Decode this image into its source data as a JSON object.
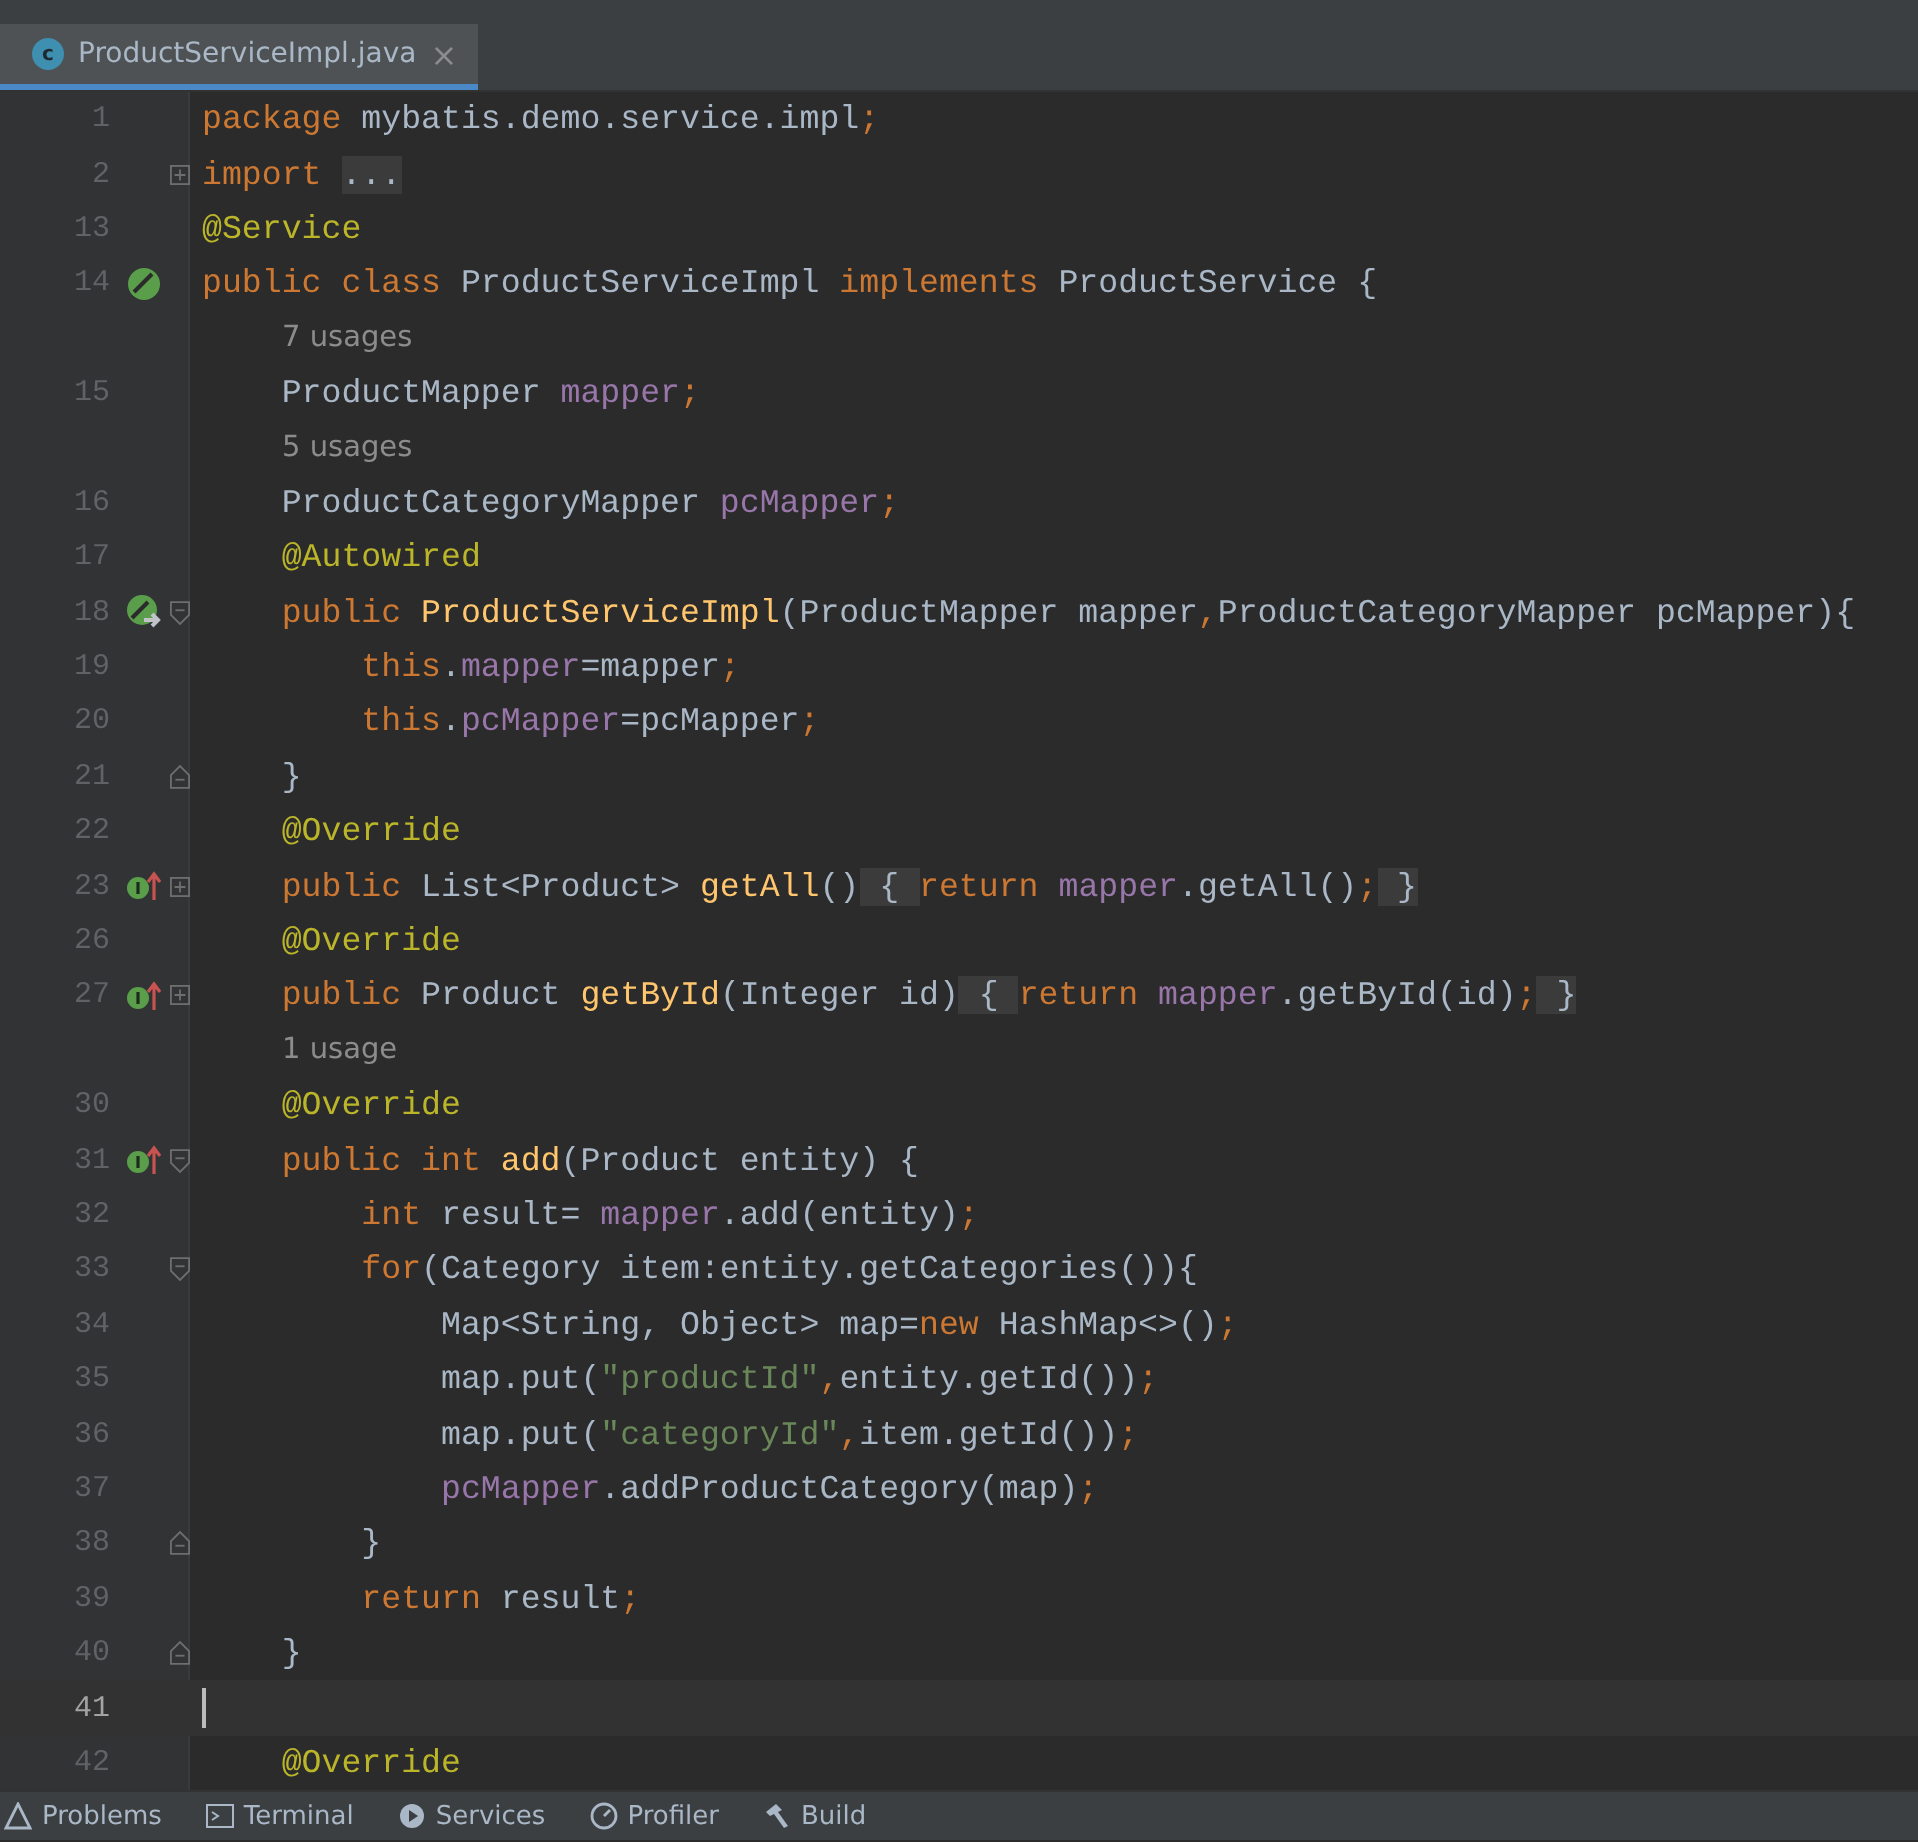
{
  "tab": {
    "title": "ProductServiceImpl.java",
    "icon_letter": "c",
    "close": "×",
    "selected": true
  },
  "lines": [
    {
      "kind": "code",
      "number": "1",
      "current": false,
      "tokens": [
        {
          "kind": "kw",
          "text": "package "
        },
        {
          "kind": "plain",
          "text": "mybatis.demo.service.impl"
        },
        {
          "kind": "kw",
          "text": ";"
        }
      ]
    },
    {
      "kind": "code",
      "number": "2",
      "current": false,
      "fold_marker": {
        "kind": "collapsed"
      },
      "tokens": [
        {
          "kind": "kw",
          "text": "import "
        },
        {
          "kind": "fold",
          "text": "..."
        }
      ]
    },
    {
      "kind": "code",
      "number": "13",
      "current": false,
      "tokens": [
        {
          "kind": "ann",
          "text": "@Service"
        }
      ]
    },
    {
      "kind": "code",
      "number": "14",
      "current": false,
      "gutter_icon": {
        "kind": "bean"
      },
      "tokens": [
        {
          "kind": "kw",
          "text": "public class "
        },
        {
          "kind": "plain",
          "text": "ProductServiceImpl "
        },
        {
          "kind": "kw",
          "text": "implements "
        },
        {
          "kind": "plain",
          "text": "ProductService {"
        }
      ]
    },
    {
      "kind": "hint",
      "text": "7 usages"
    },
    {
      "kind": "code",
      "number": "15",
      "current": false,
      "tokens": [
        {
          "kind": "plain",
          "text": "    ProductMapper "
        },
        {
          "kind": "field",
          "text": "mapper"
        },
        {
          "kind": "kw",
          "text": ";"
        }
      ]
    },
    {
      "kind": "hint",
      "text": "5 usages"
    },
    {
      "kind": "code",
      "number": "16",
      "current": false,
      "tokens": [
        {
          "kind": "plain",
          "text": "    ProductCategoryMapper "
        },
        {
          "kind": "field",
          "text": "pcMapper"
        },
        {
          "kind": "kw",
          "text": ";"
        }
      ]
    },
    {
      "kind": "code",
      "number": "17",
      "current": false,
      "tokens": [
        {
          "kind": "ann",
          "text": "    @Autowired"
        }
      ]
    },
    {
      "kind": "code",
      "number": "18",
      "current": false,
      "gutter_icon": {
        "kind": "autowired"
      },
      "fold_marker": {
        "kind": "start"
      },
      "tokens": [
        {
          "kind": "kw",
          "text": "    public "
        },
        {
          "kind": "decl",
          "text": "ProductServiceImpl"
        },
        {
          "kind": "plain",
          "text": "(ProductMapper mapper"
        },
        {
          "kind": "kw",
          "text": ","
        },
        {
          "kind": "plain",
          "text": "ProductCategoryMapper pcMapper){"
        }
      ]
    },
    {
      "kind": "code",
      "number": "19",
      "current": false,
      "tokens": [
        {
          "kind": "kw",
          "text": "        this"
        },
        {
          "kind": "plain",
          "text": "."
        },
        {
          "kind": "field",
          "text": "mapper"
        },
        {
          "kind": "plain",
          "text": "=mapper"
        },
        {
          "kind": "kw",
          "text": ";"
        }
      ]
    },
    {
      "kind": "code",
      "number": "20",
      "current": false,
      "tokens": [
        {
          "kind": "kw",
          "text": "        this"
        },
        {
          "kind": "plain",
          "text": "."
        },
        {
          "kind": "field",
          "text": "pcMapper"
        },
        {
          "kind": "plain",
          "text": "=pcMapper"
        },
        {
          "kind": "kw",
          "text": ";"
        }
      ]
    },
    {
      "kind": "code",
      "number": "21",
      "current": false,
      "fold_marker": {
        "kind": "end"
      },
      "tokens": [
        {
          "kind": "plain",
          "text": "    }"
        }
      ]
    },
    {
      "kind": "code",
      "number": "22",
      "current": false,
      "tokens": [
        {
          "kind": "ann",
          "text": "    @Override"
        }
      ]
    },
    {
      "kind": "code",
      "number": "23",
      "current": false,
      "gutter_icon": {
        "kind": "implements"
      },
      "fold_marker": {
        "kind": "collapsed"
      },
      "tokens": [
        {
          "kind": "kw",
          "text": "    public "
        },
        {
          "kind": "plain",
          "text": "List<Product> "
        },
        {
          "kind": "decl",
          "text": "getAll"
        },
        {
          "kind": "plain",
          "text": "()"
        },
        {
          "kind": "fold",
          "text": " { "
        },
        {
          "kind": "kw",
          "text": "return "
        },
        {
          "kind": "field",
          "text": "mapper"
        },
        {
          "kind": "plain",
          "text": ".getAll()"
        },
        {
          "kind": "kw",
          "text": ";"
        },
        {
          "kind": "fold",
          "text": " }"
        }
      ]
    },
    {
      "kind": "code",
      "number": "26",
      "current": false,
      "tokens": [
        {
          "kind": "ann",
          "text": "    @Override"
        }
      ]
    },
    {
      "kind": "code",
      "number": "27",
      "current": false,
      "gutter_icon": {
        "kind": "implements"
      },
      "fold_marker": {
        "kind": "collapsed"
      },
      "tokens": [
        {
          "kind": "kw",
          "text": "    public "
        },
        {
          "kind": "plain",
          "text": "Product "
        },
        {
          "kind": "decl",
          "text": "getById"
        },
        {
          "kind": "plain",
          "text": "(Integer id)"
        },
        {
          "kind": "fold",
          "text": " { "
        },
        {
          "kind": "kw",
          "text": "return "
        },
        {
          "kind": "field",
          "text": "mapper"
        },
        {
          "kind": "plain",
          "text": ".getById(id)"
        },
        {
          "kind": "kw",
          "text": ";"
        },
        {
          "kind": "fold",
          "text": " }"
        }
      ]
    },
    {
      "kind": "hint",
      "text": "1 usage"
    },
    {
      "kind": "code",
      "number": "30",
      "current": false,
      "tokens": [
        {
          "kind": "ann",
          "text": "    @Override"
        }
      ]
    },
    {
      "kind": "code",
      "number": "31",
      "current": false,
      "gutter_icon": {
        "kind": "implements"
      },
      "fold_marker": {
        "kind": "start"
      },
      "tokens": [
        {
          "kind": "kw",
          "text": "    public int "
        },
        {
          "kind": "decl",
          "text": "add"
        },
        {
          "kind": "plain",
          "text": "(Product entity) {"
        }
      ]
    },
    {
      "kind": "code",
      "number": "32",
      "current": false,
      "tokens": [
        {
          "kind": "kw",
          "text": "        int "
        },
        {
          "kind": "plain",
          "text": "result= "
        },
        {
          "kind": "field",
          "text": "mapper"
        },
        {
          "kind": "plain",
          "text": ".add(entity)"
        },
        {
          "kind": "kw",
          "text": ";"
        }
      ]
    },
    {
      "kind": "code",
      "number": "33",
      "current": false,
      "fold_marker": {
        "kind": "start"
      },
      "tokens": [
        {
          "kind": "kw",
          "text": "        for"
        },
        {
          "kind": "plain",
          "text": "(Category item:entity.getCategories()){"
        }
      ]
    },
    {
      "kind": "code",
      "number": "34",
      "current": false,
      "tokens": [
        {
          "kind": "plain",
          "text": "            Map<String, Object> map="
        },
        {
          "kind": "kw",
          "text": "new "
        },
        {
          "kind": "plain",
          "text": "HashMap<>()"
        },
        {
          "kind": "kw",
          "text": ";"
        }
      ]
    },
    {
      "kind": "code",
      "number": "35",
      "current": false,
      "tokens": [
        {
          "kind": "plain",
          "text": "            map.put("
        },
        {
          "kind": "str",
          "text": "\"productId\""
        },
        {
          "kind": "kw",
          "text": ","
        },
        {
          "kind": "plain",
          "text": "entity.getId())"
        },
        {
          "kind": "kw",
          "text": ";"
        }
      ]
    },
    {
      "kind": "code",
      "number": "36",
      "current": false,
      "tokens": [
        {
          "kind": "plain",
          "text": "            map.put("
        },
        {
          "kind": "str",
          "text": "\"categoryId\""
        },
        {
          "kind": "kw",
          "text": ","
        },
        {
          "kind": "plain",
          "text": "item.getId())"
        },
        {
          "kind": "kw",
          "text": ";"
        }
      ]
    },
    {
      "kind": "code",
      "number": "37",
      "current": false,
      "tokens": [
        {
          "kind": "field",
          "text": "            pcMapper"
        },
        {
          "kind": "plain",
          "text": ".addProductCategory(map)"
        },
        {
          "kind": "kw",
          "text": ";"
        }
      ]
    },
    {
      "kind": "code",
      "number": "38",
      "current": false,
      "fold_marker": {
        "kind": "end"
      },
      "tokens": [
        {
          "kind": "plain",
          "text": "        }"
        }
      ]
    },
    {
      "kind": "code",
      "number": "39",
      "current": false,
      "tokens": [
        {
          "kind": "kw",
          "text": "        return "
        },
        {
          "kind": "plain",
          "text": "result"
        },
        {
          "kind": "kw",
          "text": ";"
        }
      ]
    },
    {
      "kind": "code",
      "number": "40",
      "current": false,
      "fold_marker": {
        "kind": "end"
      },
      "tokens": [
        {
          "kind": "plain",
          "text": "    }"
        }
      ]
    },
    {
      "kind": "code",
      "number": "41",
      "current": true
    },
    {
      "kind": "code",
      "number": "42",
      "current": false,
      "tokens": [
        {
          "kind": "ann",
          "text": "    @Override"
        }
      ]
    }
  ],
  "tool_windows": [
    {
      "kind": "problems",
      "label": "Problems"
    },
    {
      "kind": "terminal",
      "label": "Terminal"
    },
    {
      "kind": "services",
      "label": "Services"
    },
    {
      "kind": "profiler",
      "label": "Profiler"
    },
    {
      "kind": "build",
      "label": "Build"
    }
  ]
}
